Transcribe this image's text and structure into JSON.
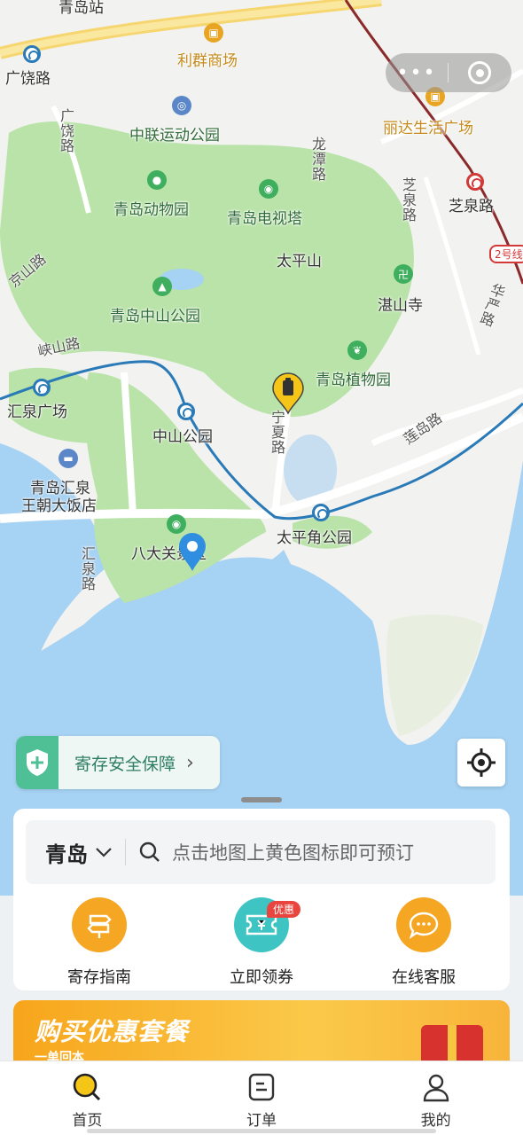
{
  "map": {
    "labels": {
      "qingdao_station_partial": "青岛站",
      "lique_mall": "利群商场",
      "guangrao_road": "广饶路",
      "guangrao_road_vertical": "广饶路",
      "zhonglian_park": "中联运动公园",
      "zoo": "青岛动物园",
      "tv_tower": "青岛电视塔",
      "longtan_road": "龙潭路",
      "zhiquan_road_vertical": "芝泉路",
      "zhiquan_road": "芝泉路",
      "lida_plaza": "丽达生活广场",
      "jingshan_road": "京山路",
      "taiping_mountain": "太平山",
      "zhanshan_temple": "湛山寺",
      "zhongshan_park": "青岛中山公园",
      "huayan_road": "华严路",
      "xiashan_road": "峡山路",
      "botanical_garden": "青岛植物园",
      "huiquan_square": "汇泉广场",
      "zhongshan_park_station": "中山公园",
      "hotel_line1": "青岛汇泉",
      "hotel_line2": "王朝大饭店",
      "lianyang_road": "莲岛路",
      "taipingjiao_park": "太平角公园",
      "badaguan": "八大关景区",
      "huiquan_road": "汇泉路",
      "line2_badge": "2号线",
      "yanming_road": "宁夏路"
    }
  },
  "capsule": {
    "more": "•••"
  },
  "safety_banner": {
    "label": "寄存安全保障",
    "chevron": "›"
  },
  "search": {
    "city": "青岛",
    "placeholder": "点击地图上黄色图标即可预订"
  },
  "quick_actions": [
    {
      "label": "寄存指南",
      "color": "#f5a623"
    },
    {
      "label": "立即领券",
      "color": "#3fc4c4",
      "badge": "优惠"
    },
    {
      "label": "在线客服",
      "color": "#f5a623"
    }
  ],
  "promo": {
    "title": "购买优惠套餐",
    "subtitle": "一单回本"
  },
  "tabs": [
    {
      "label": "首页",
      "active": true
    },
    {
      "label": "订单",
      "active": false
    },
    {
      "label": "我的",
      "active": false
    }
  ]
}
